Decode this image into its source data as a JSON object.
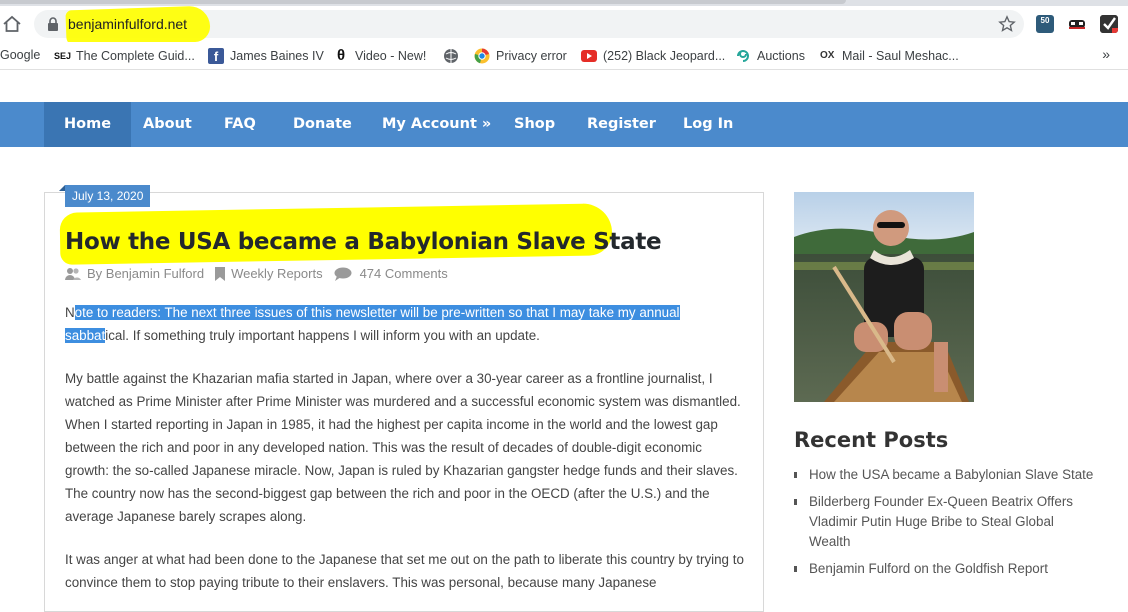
{
  "browser": {
    "url": "benjaminfulford.net",
    "extension_badge": "50",
    "bookmarks": [
      {
        "label": "Google",
        "icon": "google-icon"
      },
      {
        "label": "The Complete Guid...",
        "icon": "sej-icon"
      },
      {
        "label": "James Baines IV",
        "icon": "facebook-icon"
      },
      {
        "label": "Video - New!",
        "icon": "theta-icon"
      },
      {
        "label": "",
        "icon": "globe-icon"
      },
      {
        "label": "Privacy error",
        "icon": "chrome-icon"
      },
      {
        "label": "(252) Black Jeopard...",
        "icon": "youtube-icon"
      },
      {
        "label": "Auctions",
        "icon": "auction-icon"
      },
      {
        "label": "Mail - Saul Meshac...",
        "icon": "outlook-icon"
      }
    ],
    "more_label": "»"
  },
  "nav": {
    "items": [
      "Home",
      "About",
      "FAQ",
      "Donate",
      "My Account »",
      "Shop",
      "Register",
      "Log In"
    ],
    "active": "Home",
    "color": "#4b8acc"
  },
  "article": {
    "date": "July 13, 2020",
    "title": "How the USA became a Babylonian Slave State",
    "author": "By Benjamin Fulford",
    "category": "Weekly Reports",
    "comments": "474 Comments",
    "p1_pre": "N",
    "p1_sel_a": "ote to readers: The next three issues of this newsletter will be pre-written so that I may take my annual",
    "p1_sel_b": "sabbat",
    "p1_post": "ical. If something truly important happens I will inform you with an update.",
    "p2": "My battle against the Khazarian mafia started in Japan, where over a 30-year career as a frontline journalist, I watched as Prime Minister after Prime Minister was murdered and a successful economic system was dismantled.  When I started reporting in Japan in 1985, it had the highest per capita income in the world and the lowest gap between the rich and poor in any developed nation.  This was the result of decades of double-digit economic growth: the so-called Japanese miracle.  Now, Japan is ruled by Khazarian gangster hedge funds and their slaves.  The country now has the second-biggest gap between the rich and poor in the OECD (after the U.S.) and the average Japanese barely scrapes along.",
    "p3": "It was anger at what had been done to the Japanese that set me out on the path to liberate this country by trying to convince them to stop paying tribute to their enslavers.  This was personal, because many Japanese"
  },
  "sidebar": {
    "recent_title": "Recent Posts",
    "recent_posts": [
      "How the USA became a Babylonian Slave State",
      "Bilderberg Founder Ex-Queen Beatrix Offers Vladimir Putin Huge Bribe to Steal Global Wealth",
      "Benjamin Fulford on the Goldfish Report"
    ]
  }
}
